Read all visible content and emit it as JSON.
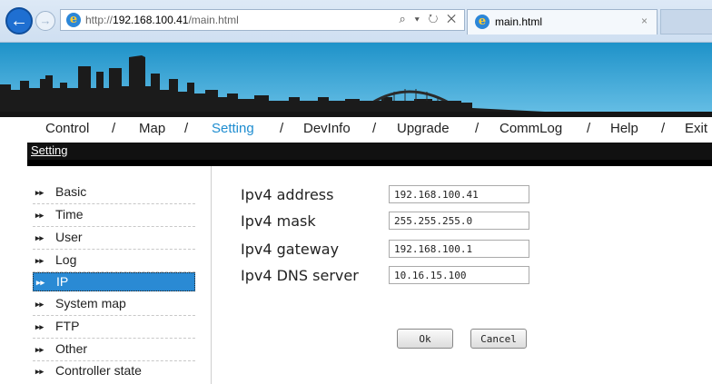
{
  "browser": {
    "url_prefix": "http://",
    "url_host": "192.168.100.41",
    "url_path": "/main.html",
    "tab_title": "main.html",
    "search_glyph": "⌕ ▾ ↻ ✕",
    "close_glyph": "×"
  },
  "topnav": {
    "items": [
      "Control",
      "Map",
      "Setting",
      "DevInfo",
      "Upgrade",
      "CommLog",
      "Help",
      "Exit"
    ],
    "separator": "/",
    "active": "Setting"
  },
  "section_title": "Setting",
  "sidebar": {
    "bullet": "▸▸",
    "items": [
      {
        "label": "Basic"
      },
      {
        "label": "Time"
      },
      {
        "label": "User"
      },
      {
        "label": "Log"
      },
      {
        "label": "IP"
      },
      {
        "label": "System map"
      },
      {
        "label": "FTP"
      },
      {
        "label": "Other"
      },
      {
        "label": "Controller state"
      }
    ],
    "active": "IP"
  },
  "form": {
    "ipv4_address": {
      "label": "Ipv4 address",
      "value": "192.168.100.41"
    },
    "ipv4_mask": {
      "label": "Ipv4 mask",
      "value": "255.255.255.0"
    },
    "ipv4_gateway": {
      "label": "Ipv4 gateway",
      "value": "192.168.100.1"
    },
    "ipv4_dns": {
      "label": "Ipv4 DNS server",
      "value": "10.16.15.100"
    },
    "ok_label": "Ok",
    "cancel_label": "Cancel"
  },
  "colors": {
    "active_nav": "#1f8dd0",
    "active_sidebar": "#2a8ad4",
    "banner_top": "#1e92c9",
    "banner_bottom": "#6cc0e4"
  }
}
